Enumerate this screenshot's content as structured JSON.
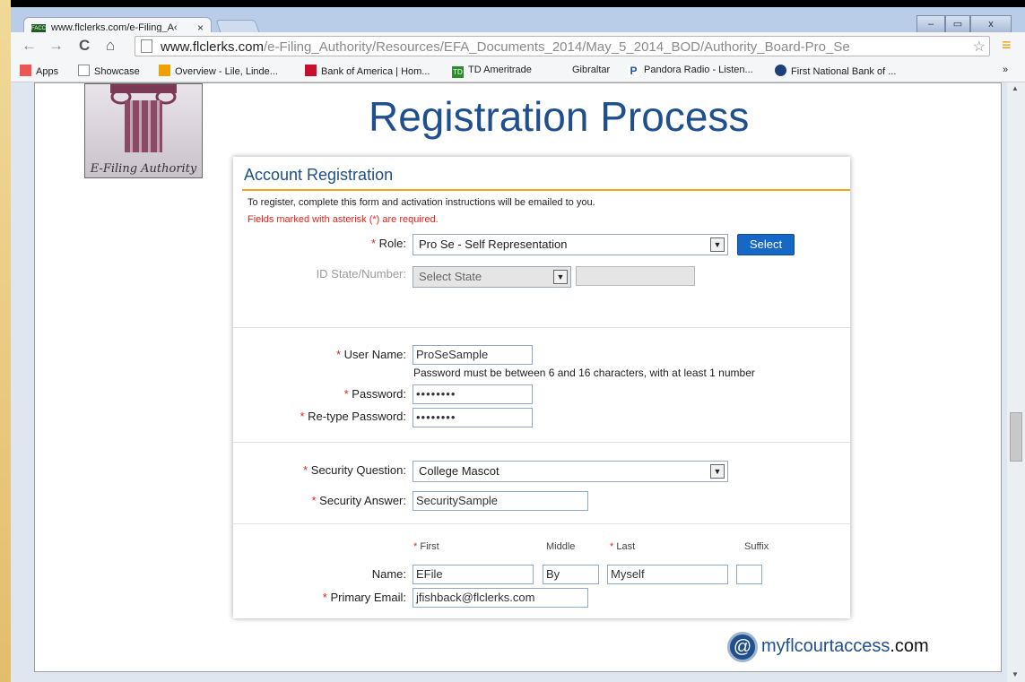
{
  "browser": {
    "tab_title": "www.flclerks.com/e-Filing_A\u0001",
    "favicon_text": "FACC",
    "tab_close": "×",
    "url_host": "www.flclerks.com",
    "url_path": "/e-Filing_Authority/Resources/EFA_Documents_2014/May_5_2014_BOD/Authority_Board-Pro_Se",
    "window_controls": [
      "–",
      "▭",
      "x"
    ]
  },
  "bookmarks": [
    {
      "label": "Apps",
      "icon": "apps-grid-icon",
      "color": "#e55"
    },
    {
      "label": "Showcase",
      "icon": "page-icon",
      "color": "#888"
    },
    {
      "label": "Overview - Lile, Linde...",
      "icon": "lily-icon",
      "color": "#f0a000"
    },
    {
      "label": "Bank of America | Hom...",
      "icon": "boa-icon",
      "color": "#c8102e"
    },
    {
      "label": "TD Ameritrade",
      "icon": "td-icon",
      "color": "#2d8a2d"
    },
    {
      "label": "Gibraltar",
      "icon": "none",
      "color": "#fff"
    },
    {
      "label": "Pandora Radio - Listen...",
      "icon": "pandora-icon",
      "color": "#2054a6"
    },
    {
      "label": "First National Bank of ...",
      "icon": "fnb-icon",
      "color": "#1d3f7a"
    }
  ],
  "bookmarks_more": "»",
  "page": {
    "logo_caption": "E-Filing Authority",
    "heading": "Registration Process",
    "brand_symbol": "@",
    "brand_name": "myflcourtaccess",
    "brand_suffix": ".com"
  },
  "form": {
    "title": "Account Registration",
    "instructions": "To register, complete this form and activation instructions will be emailed to you.",
    "required_note": "Fields marked with asterisk (*) are required.",
    "role_label": "Role:",
    "role_value": "Pro Se - Self Representation",
    "select_button": "Select",
    "id_label": "ID State/Number:",
    "id_state_value": "Select State",
    "id_number_value": "",
    "username_label": "User Name:",
    "username_value": "ProSeSample",
    "password_hint": "Password must be between 6 and 16 characters, with at least 1 number",
    "password_label": "Password:",
    "password_value": "••••••••",
    "retype_label": "Re-type Password:",
    "retype_value": "••••••••",
    "security_question_label": "Security Question:",
    "security_question_value": "College Mascot",
    "security_answer_label": "Security Answer:",
    "security_answer_value": "SecuritySample",
    "first_header": "First",
    "middle_header": "Middle",
    "last_header": "Last",
    "suffix_header": "Suffix",
    "name_label": "Name:",
    "first_value": "EFile",
    "middle_value": "By",
    "last_value": "Myself",
    "suffix_value": "",
    "email_label": "Primary Email:",
    "email_value": "jfishback@flclerks.com",
    "asterisk": "*"
  },
  "colors": {
    "heading": "#1f4f8f",
    "button": "#1767c7",
    "required": "#e0241b",
    "accent_line": "#f3a21a"
  }
}
